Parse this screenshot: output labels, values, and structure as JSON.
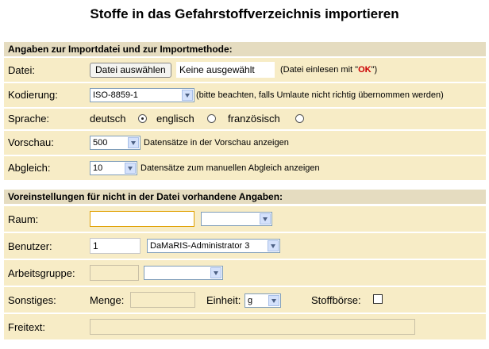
{
  "title": "Stoffe in das Gefahrstoffverzeichnis importieren",
  "section1": "Angaben zur Importdatei und zur Importmethode:",
  "section2": "Voreinstellungen für nicht in der Datei vorhandene Angaben:",
  "file": {
    "label": "Datei:",
    "button": "Datei auswählen",
    "status": "Keine ausgewählt",
    "hint_prefix": "(Datei einlesen mit \"",
    "hint_ok": "OK",
    "hint_suffix": "\")"
  },
  "encoding": {
    "label": "Kodierung:",
    "value": "ISO-8859-1",
    "hint": "(bitte beachten, falls Umlaute nicht richtig übernommen werden)"
  },
  "language": {
    "label": "Sprache:",
    "options": [
      "deutsch",
      "englisch",
      "französisch"
    ],
    "selected": "deutsch"
  },
  "preview": {
    "label": "Vorschau:",
    "value": "500",
    "text": "Datensätze in der Vorschau anzeigen"
  },
  "match": {
    "label": "Abgleich:",
    "value": "10",
    "text": "Datensätze zum manuellen Abgleich anzeigen"
  },
  "room": {
    "label": "Raum:",
    "value": "",
    "select_value": ""
  },
  "user": {
    "label": "Benutzer:",
    "id": "1",
    "select_value": "DaMaRIS-Administrator 3"
  },
  "workgroup": {
    "label": "Arbeitsgruppe:",
    "value": "",
    "select_value": ""
  },
  "misc": {
    "label": "Sonstiges:",
    "amount_label": "Menge:",
    "amount_value": "",
    "unit_label": "Einheit:",
    "unit_value": "g",
    "exchange_label": "Stoffbörse:",
    "exchange_checked": false
  },
  "freetext": {
    "label": "Freitext:",
    "value": ""
  },
  "colors": {
    "row_bg": "#f7ecc6",
    "section_bg": "#e5dcc0",
    "ok_red": "#cc0000"
  }
}
